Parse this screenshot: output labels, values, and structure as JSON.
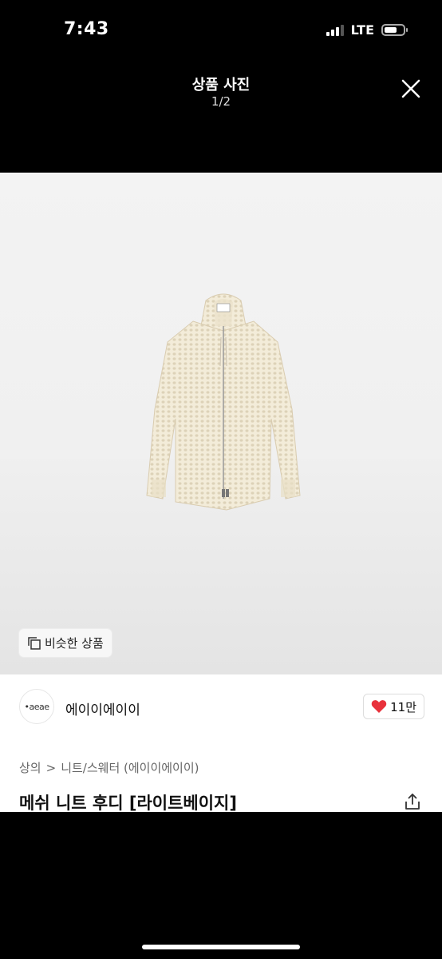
{
  "status_bar": {
    "time": "7:43",
    "network": "LTE"
  },
  "viewer": {
    "title": "상품 사진",
    "counter": "1/2"
  },
  "photo": {
    "similar_button_label": "비슷한 상품",
    "garment_color": "#f1ead7"
  },
  "shop": {
    "avatar_text": "•aeae",
    "name": "에이이에이이"
  },
  "like": {
    "count": "11만",
    "heart_color": "#e8313b"
  },
  "breadcrumb": {
    "category": "상의",
    "separator": ">",
    "subcategory": "니트/스웨터 (에이이에이이)"
  },
  "product": {
    "title": "메쉬 니트 후디 [라이트베이지]"
  }
}
